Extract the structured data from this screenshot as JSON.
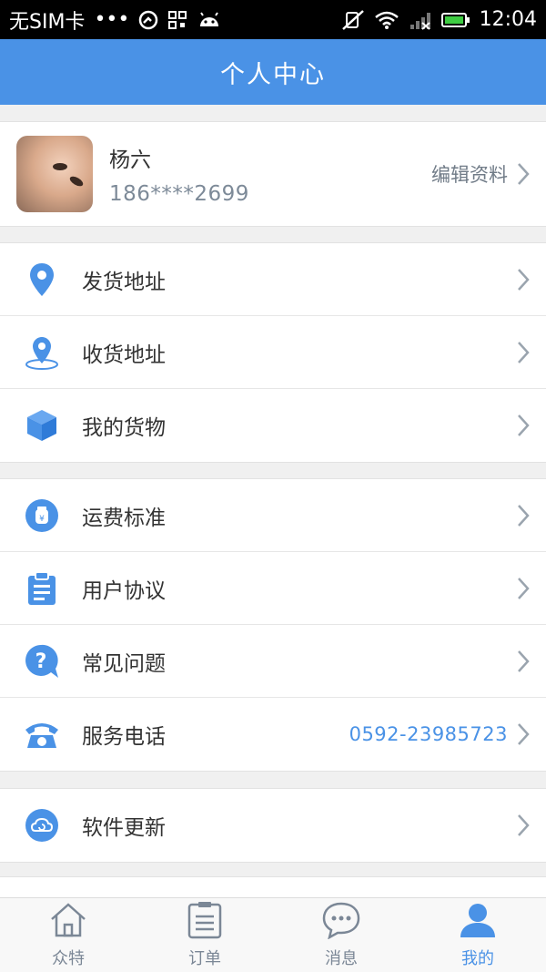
{
  "status_bar": {
    "carrier": "无SIM卡",
    "dots": "•••",
    "time": "12:04"
  },
  "header": {
    "title": "个人中心"
  },
  "profile": {
    "name": "杨六",
    "phone": "186****2699",
    "edit_label": "编辑资料"
  },
  "menu_group1": [
    {
      "label": "发货地址",
      "icon": "location-pin-icon"
    },
    {
      "label": "收货地址",
      "icon": "location-target-icon"
    },
    {
      "label": "我的货物",
      "icon": "cube-icon"
    }
  ],
  "menu_group2": [
    {
      "label": "运费标准",
      "icon": "money-bag-icon"
    },
    {
      "label": "用户协议",
      "icon": "clipboard-icon"
    },
    {
      "label": "常见问题",
      "icon": "question-icon"
    },
    {
      "label": "服务电话",
      "icon": "telephone-icon",
      "value": "0592-23985723"
    }
  ],
  "menu_group3": [
    {
      "label": "软件更新",
      "icon": "cloud-update-icon"
    }
  ],
  "tabs": [
    {
      "label": "众特",
      "icon": "home-icon",
      "active": false
    },
    {
      "label": "订单",
      "icon": "list-icon",
      "active": false
    },
    {
      "label": "消息",
      "icon": "chat-icon",
      "active": false
    },
    {
      "label": "我的",
      "icon": "user-icon",
      "active": true
    }
  ],
  "colors": {
    "accent": "#4a92e6",
    "icon_gray": "#7b8796"
  }
}
